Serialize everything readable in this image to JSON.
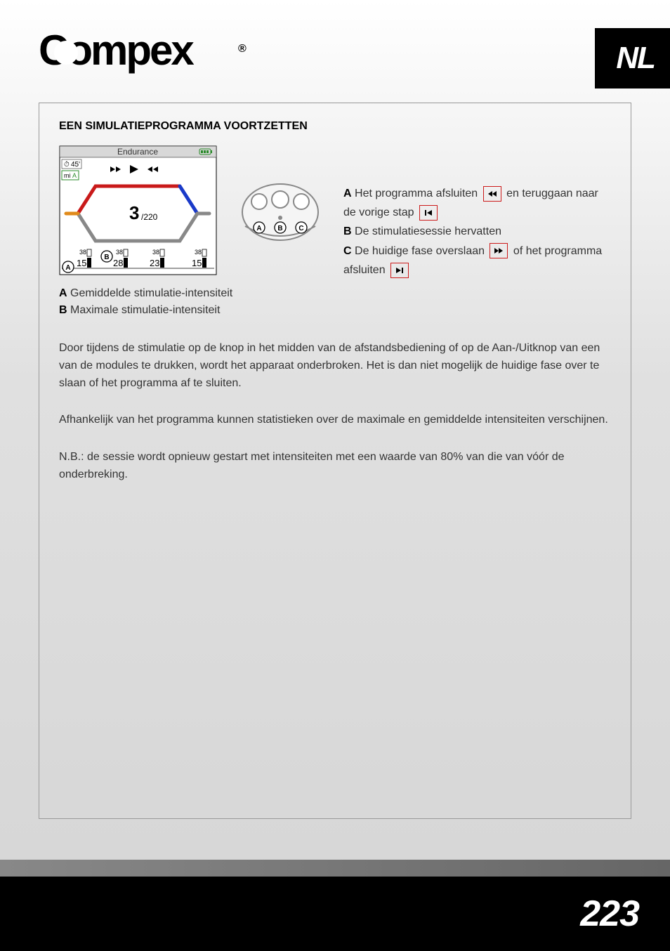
{
  "header": {
    "brand": "Compex",
    "reg": "®",
    "lang": "NL"
  },
  "section": {
    "title": "EEN SIMULATIEPROGRAMMA VOORTZETTEN"
  },
  "screen": {
    "title": "Endurance",
    "timer": "45'",
    "unit": "miA",
    "big_num": "3",
    "big_sub": "/220",
    "ch_top1": "38",
    "ch_top2": "38",
    "ch_top3": "38",
    "ch_top4": "38",
    "ch1": "15",
    "ch2": "28",
    "ch3": "23",
    "ch4": "15",
    "marker_a": "A",
    "marker_b": "B"
  },
  "remote": {
    "a": "A",
    "b": "B",
    "c": "C"
  },
  "legend_right": {
    "a_label": "A",
    "a_text1": " Het programma afsluiten ",
    "a_text2": " en teruggaan naar de vorige stap ",
    "b_label": "B",
    "b_text": " De stimulatiesessie hervatten",
    "c_label": "C",
    "c_text1": " De huidige fase overslaan ",
    "c_text2": " of het programma afsluiten "
  },
  "legend_below": {
    "a_label": "A",
    "a_text": " Gemiddelde stimulatie-intensiteit",
    "b_label": "B",
    "b_text": " Maximale stimulatie-intensiteit"
  },
  "paragraphs": {
    "p1": "Door tijdens de stimulatie op de knop in het midden van de afstandsbediening of op de Aan-/Uitknop van een van de modules te drukken, wordt het apparaat onderbroken. Het is dan niet mogelijk de huidige fase over te slaan of het programma af te sluiten.",
    "p2": "Afhankelijk van het programma kunnen statistieken over de maximale en gemiddelde intensiteiten verschijnen.",
    "p3": "N.B.: de sessie wordt opnieuw gestart met intensiteiten met een waarde van 80% van die van vóór de onderbreking."
  },
  "footer": {
    "page": "223"
  }
}
